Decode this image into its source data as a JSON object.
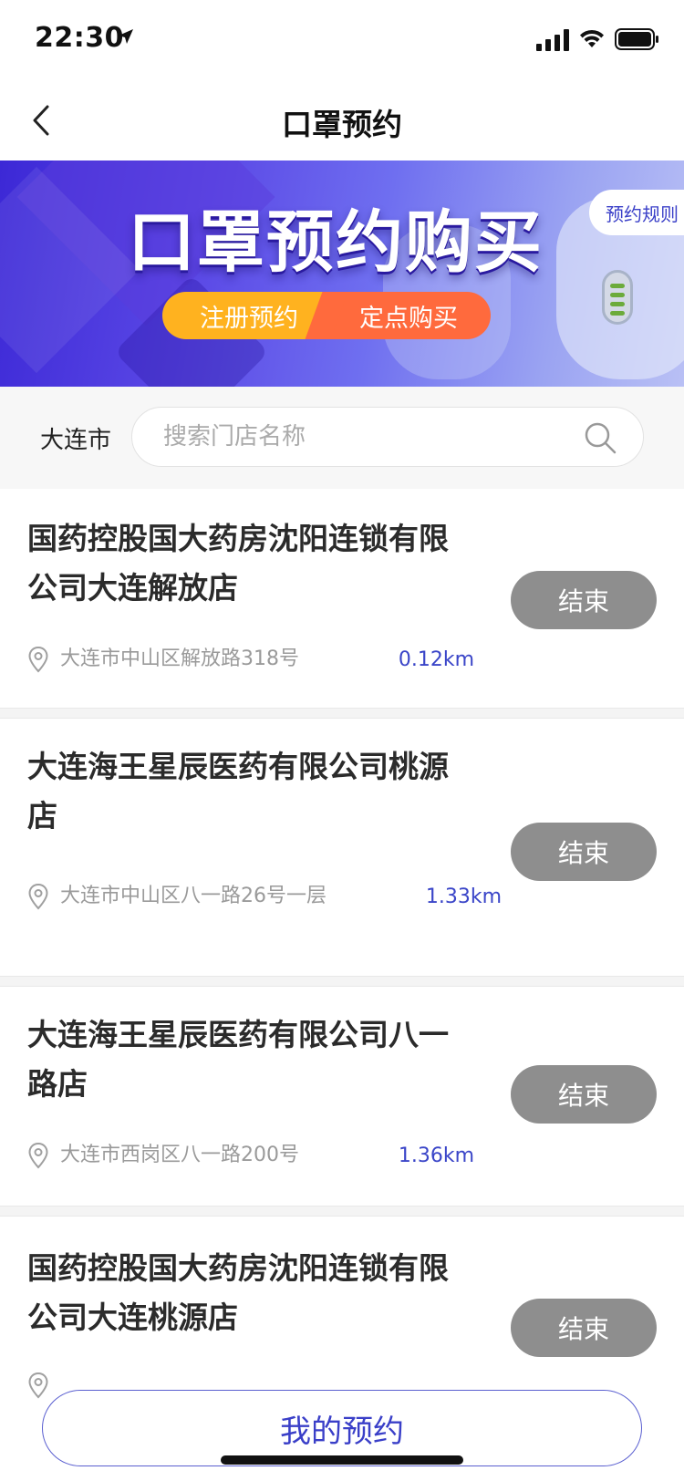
{
  "status_bar": {
    "time": "22:30"
  },
  "nav": {
    "title": "口罩预约"
  },
  "banner": {
    "title": "口罩预约购买",
    "pill_left": "注册预约",
    "pill_right": "定点购买",
    "rules_label": "预约规则"
  },
  "search": {
    "city": "大连市",
    "placeholder": "搜索门店名称",
    "value": ""
  },
  "stores": [
    {
      "name": "国药控股国大药房沈阳连锁有限公司大连解放店",
      "address": "大连市中山区解放路318号",
      "distance": "0.12km",
      "status": "结束"
    },
    {
      "name": "大连海王星辰医药有限公司桃源店",
      "address": "大连市中山区八一路26号一层",
      "distance": "1.33km",
      "status": "结束"
    },
    {
      "name": "大连海王星辰医药有限公司八一路店",
      "address": "大连市西岗区八一路200号",
      "distance": "1.36km",
      "status": "结束"
    },
    {
      "name": "国药控股国大药房沈阳连锁有限公司大连桃源店",
      "address": "",
      "distance": "",
      "status": "结束"
    }
  ],
  "bottom": {
    "my_booking": "我的预约"
  },
  "colors": {
    "accent": "#3a3fc8",
    "ended": "#8e8e8e",
    "pill_orange": "#ffb21f",
    "pill_red": "#ff6a3d"
  }
}
